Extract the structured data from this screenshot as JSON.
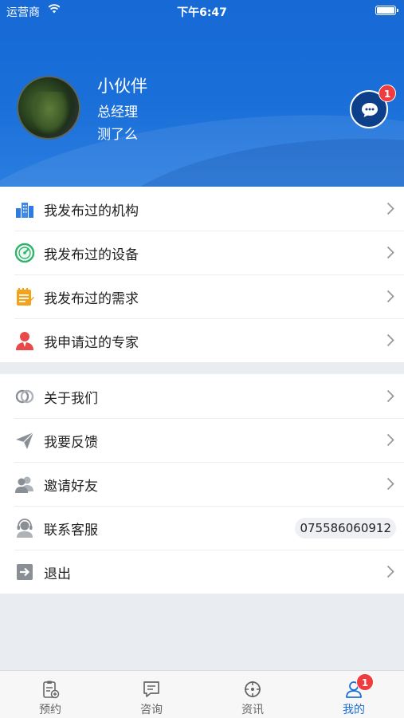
{
  "status_bar": {
    "carrier": "运营商",
    "time": "下午6:47"
  },
  "profile": {
    "name": "小伙伴",
    "title": "总经理",
    "company": "测了么",
    "message_badge": "1"
  },
  "menu_group_1": [
    {
      "label": "我发布过的机构",
      "icon": "building-icon"
    },
    {
      "label": "我发布过的设备",
      "icon": "gauge-icon"
    },
    {
      "label": "我发布过的需求",
      "icon": "notepad-icon"
    },
    {
      "label": "我申请过的专家",
      "icon": "expert-icon"
    }
  ],
  "menu_group_2": [
    {
      "label": "关于我们",
      "icon": "about-icon"
    },
    {
      "label": "我要反馈",
      "icon": "paper-plane-icon"
    },
    {
      "label": "邀请好友",
      "icon": "users-icon"
    },
    {
      "label": "联系客服",
      "icon": "headset-icon",
      "value": "075586060912"
    },
    {
      "label": "退出",
      "icon": "logout-icon"
    }
  ],
  "tabs": [
    {
      "label": "预约",
      "icon": "clipboard-icon"
    },
    {
      "label": "咨询",
      "icon": "chat-icon"
    },
    {
      "label": "资讯",
      "icon": "crosshair-icon"
    },
    {
      "label": "我的",
      "icon": "person-icon",
      "badge": "1",
      "active": true
    }
  ],
  "colors": {
    "primary": "#1a6fd9",
    "badge": "#f03c3c",
    "background": "#e9ecf0"
  }
}
